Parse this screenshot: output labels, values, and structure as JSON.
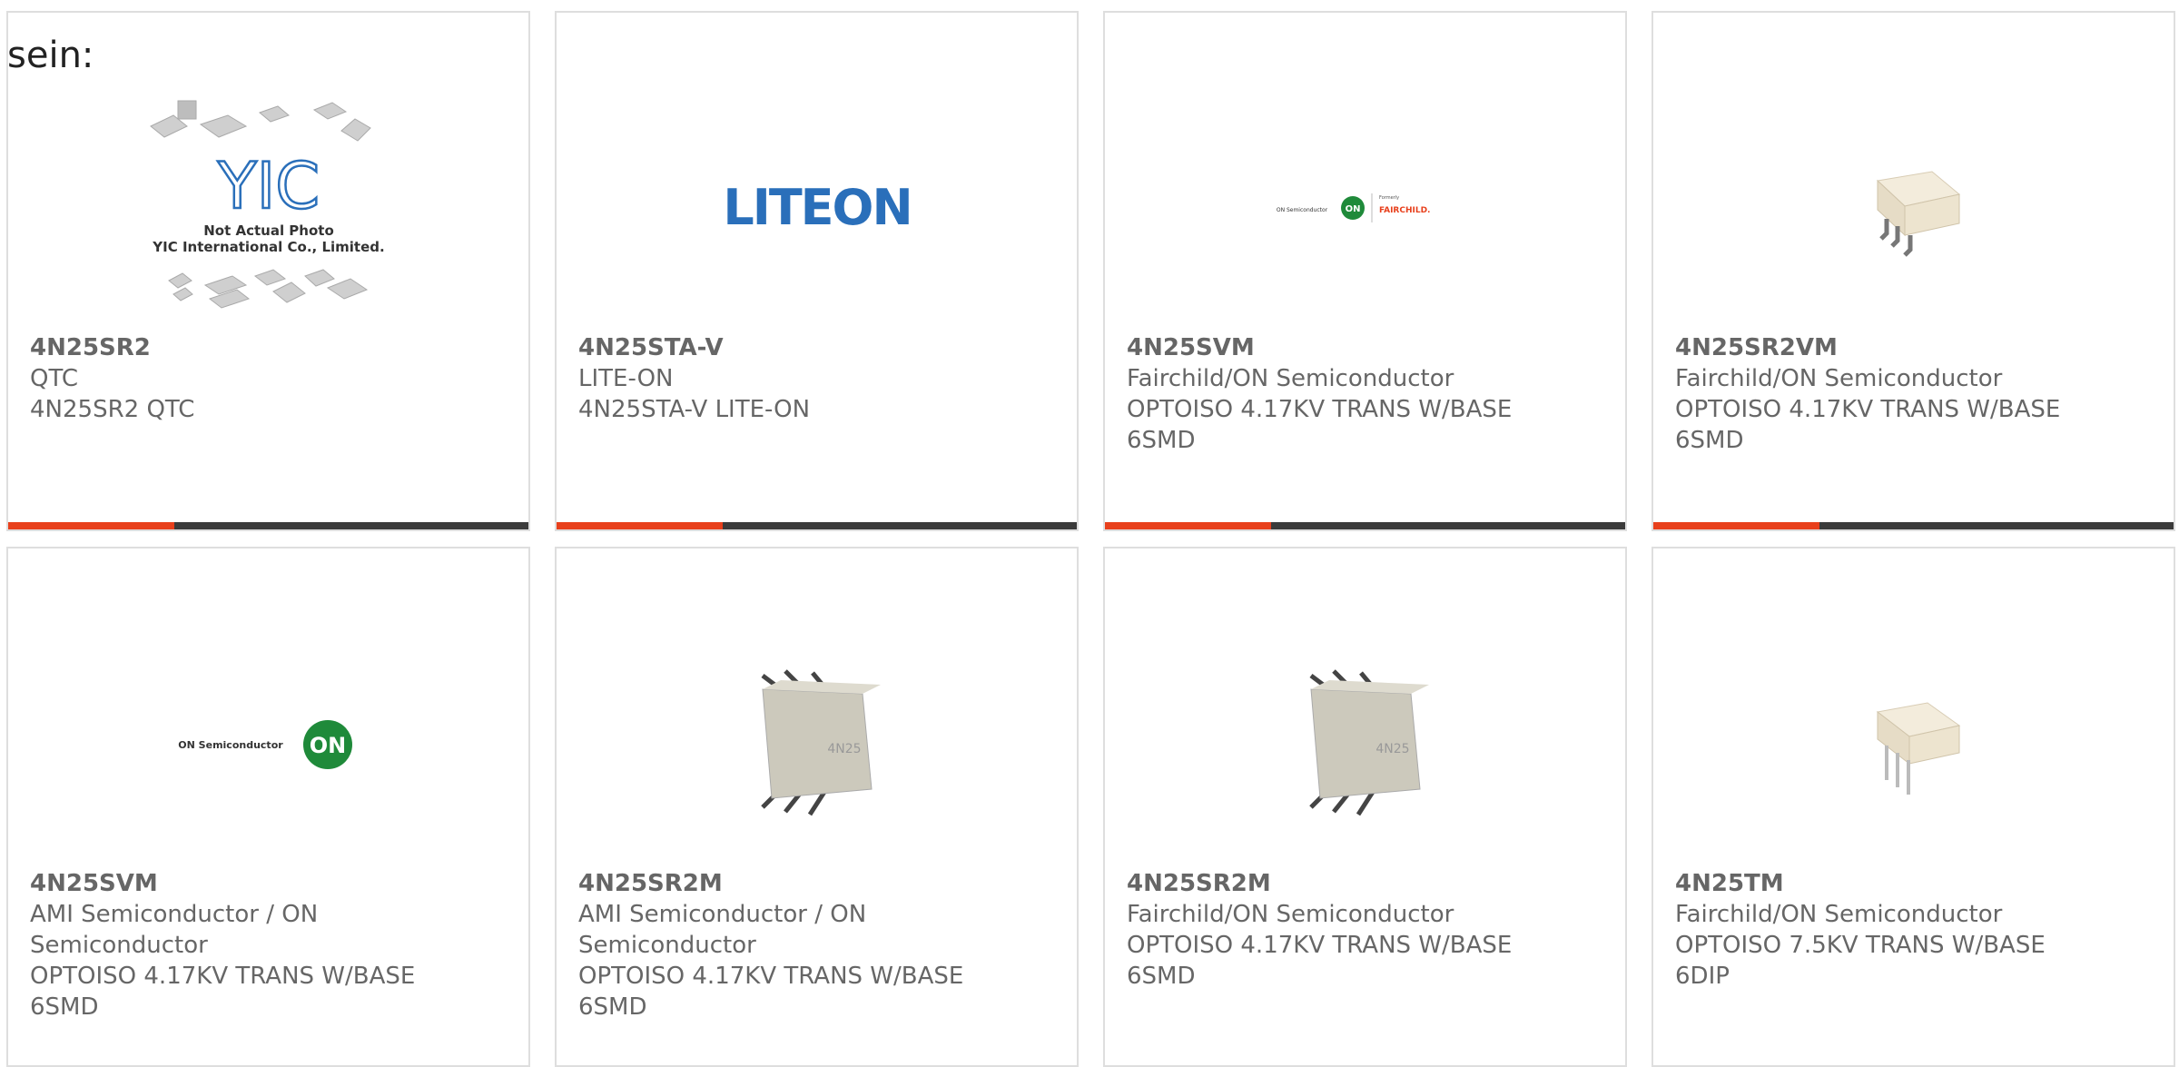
{
  "heading": "sein:",
  "placeholder_photo": {
    "line1": "Not Actual Photo",
    "line2": "YIC International Co., Limited.",
    "brand": "YIC"
  },
  "logos": {
    "liteon": "LITEON",
    "onsemi": "ON Semiconductor",
    "on_badge": "ON",
    "formerly": "Formerly",
    "fairchild": "FAIRCHILD."
  },
  "ic_marking": "4N25",
  "cards": [
    {
      "part": "4N25SR2",
      "maker": "QTC",
      "desc_lines": [
        "4N25SR2 QTC"
      ]
    },
    {
      "part": "4N25STA-V",
      "maker": "LITE-ON",
      "desc_lines": [
        "4N25STA-V LITE-ON"
      ]
    },
    {
      "part": "4N25SVM",
      "maker": "Fairchild/ON Semiconductor",
      "desc_lines": [
        "OPTOISO 4.17KV TRANS W/BASE",
        "6SMD"
      ]
    },
    {
      "part": "4N25SR2VM",
      "maker": "Fairchild/ON Semiconductor",
      "desc_lines": [
        "OPTOISO 4.17KV TRANS W/BASE",
        "6SMD"
      ]
    },
    {
      "part": "4N25SVM",
      "maker_lines": [
        "AMI Semiconductor / ON",
        "Semiconductor"
      ],
      "desc_lines": [
        "OPTOISO 4.17KV TRANS W/BASE",
        "6SMD"
      ]
    },
    {
      "part": "4N25SR2M",
      "maker_lines": [
        "AMI Semiconductor / ON",
        "Semiconductor"
      ],
      "desc_lines": [
        "OPTOISO 4.17KV TRANS W/BASE",
        "6SMD"
      ]
    },
    {
      "part": "4N25SR2M",
      "maker": "Fairchild/ON Semiconductor",
      "desc_lines": [
        "OPTOISO 4.17KV TRANS W/BASE",
        "6SMD"
      ]
    },
    {
      "part": "4N25TM",
      "maker": "Fairchild/ON Semiconductor",
      "desc_lines": [
        "OPTOISO 7.5KV TRANS W/BASE",
        "6DIP"
      ]
    }
  ],
  "colors": {
    "accent": "#e8401c",
    "bar": "#3b3b3b",
    "border": "#dedede",
    "text": "#666666",
    "liteon": "#2a6fba",
    "on_green": "#1f8a3a",
    "fairchild": "#e8401c"
  }
}
